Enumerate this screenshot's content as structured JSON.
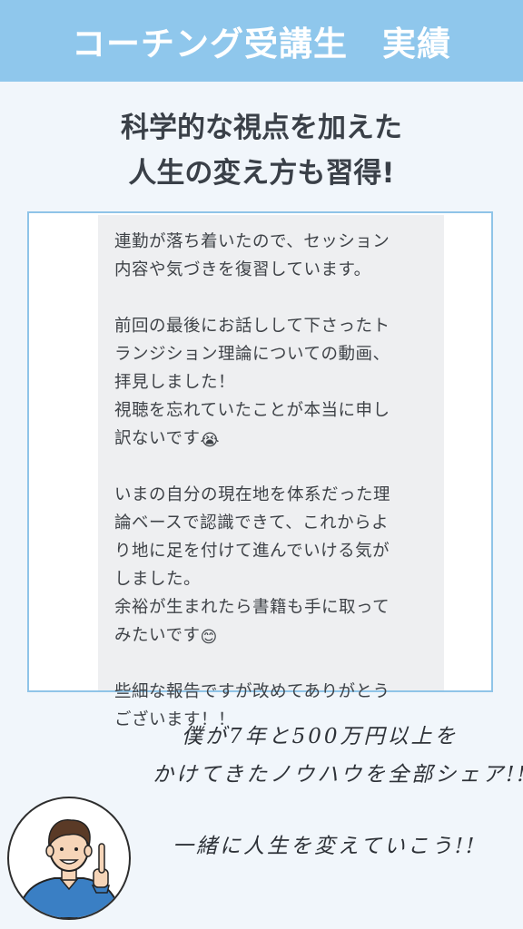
{
  "header": {
    "title": "コーチング受講生　実績"
  },
  "headline": {
    "line1": "科学的な視点を加えた",
    "line2": "人生の変え方も習得!"
  },
  "message": {
    "paragraph1": "連勤が落ち着いたので、セッション\n内容や気づきを復習しています。",
    "paragraph2_text": "前回の最後にお話しして下さったト\nランジション理論についての動画、\n拝見しました！\n視聴を忘れていたことが本当に申し\n訳ないです",
    "paragraph2_emoji": "😭",
    "paragraph3_text": "いまの自分の現在地を体系だった理\n論ベースで認識できて、これからよ\nり地に足を付けて進んでいける気が\nしました。\n余裕が生まれたら書籍も手に取って\nみたいです",
    "paragraph3_emoji": "😊",
    "paragraph4": "些細な報告ですが改めてありがとう\nございます！！"
  },
  "footer": {
    "line1": "僕が7年と500万円以上を",
    "line2": "かけてきたノウハウを全部シェア!!",
    "line3": "一緒に人生を変えていこう!!"
  },
  "colors": {
    "banner": "#8fc7ec",
    "background": "#f1f6fb",
    "card_border": "#8fc4e8",
    "bubble": "#eeeff1",
    "text": "#3f4348",
    "sweater": "#3a7fc4"
  }
}
